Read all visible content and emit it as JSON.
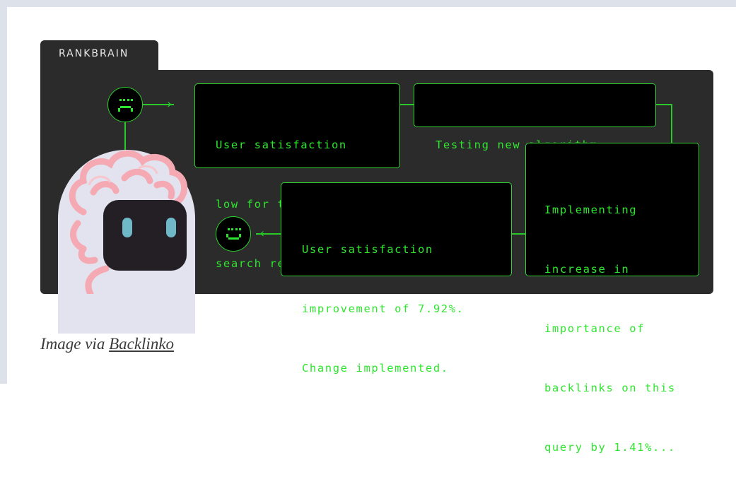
{
  "panel": {
    "tab_label": "RANKBRAIN"
  },
  "messages": {
    "low_satisfaction": [
      "User satisfaction",
      "low for these",
      "search results..."
    ],
    "testing": [
      "Testing new algorithm..."
    ],
    "implementing": [
      "Implementing",
      "increase in",
      "importance of",
      "backlinks on this",
      "query by 1.41%..."
    ],
    "improvement": [
      "User satisfaction",
      "improvement of 7.92%.",
      "Change implemented."
    ]
  },
  "icons": {
    "sad_face": "sad-face-icon",
    "happy_face": "happy-face-icon",
    "robot": "robot-brain-icon"
  },
  "colors": {
    "panel_bg": "#2b2b2b",
    "terminal_green": "#2ee62e",
    "brain_pink": "#f4a9b3",
    "robot_shell": "#e2e3ee"
  },
  "caption": {
    "prefix": "Image via",
    "link": "Backlinko"
  }
}
